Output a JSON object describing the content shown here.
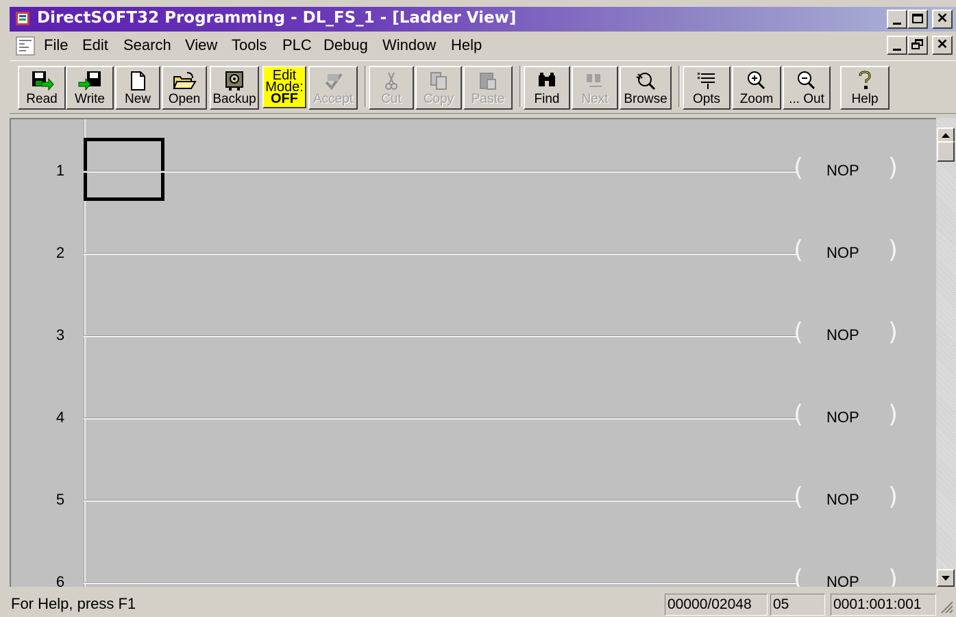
{
  "window": {
    "title": "DirectSOFT32 Programming - DL_FS_1 - [Ladder View]",
    "caption_buttons": [
      "minimize",
      "maximize",
      "close"
    ],
    "mdi_buttons": [
      "minimize",
      "restore",
      "close"
    ]
  },
  "menu": {
    "items": [
      {
        "label": "File"
      },
      {
        "label": "Edit"
      },
      {
        "label": "Search"
      },
      {
        "label": "View"
      },
      {
        "label": "Tools"
      },
      {
        "label": "PLC"
      },
      {
        "label": "Debug"
      },
      {
        "label": "Window"
      },
      {
        "label": "Help"
      }
    ]
  },
  "toolbar": {
    "read": "Read",
    "write": "Write",
    "new": "New",
    "open": "Open",
    "backup": "Backup",
    "edit_mode": {
      "line1": "Edit",
      "line2": "Mode:",
      "state": "OFF"
    },
    "accept": "Accept",
    "cut": "Cut",
    "copy": "Copy",
    "paste": "Paste",
    "find": "Find",
    "next": "Next",
    "browse": "Browse",
    "opts": "Opts",
    "zoom": "Zoom",
    "zoom_out": "... Out",
    "help": "Help"
  },
  "ladder": {
    "rungs": [
      {
        "number": "1",
        "coil": "NOP"
      },
      {
        "number": "2",
        "coil": "NOP"
      },
      {
        "number": "3",
        "coil": "NOP"
      },
      {
        "number": "4",
        "coil": "NOP"
      },
      {
        "number": "5",
        "coil": "NOP"
      },
      {
        "number": "6",
        "coil": "NOP"
      }
    ],
    "coil_left": "(",
    "coil_right": ")"
  },
  "status": {
    "help_text": "For Help, press F1",
    "memory": "00000/02048",
    "cpu": "05",
    "position": "0001:001:001"
  },
  "colors": {
    "titlebar_start": "#5c1fb0",
    "edit_mode_bg": "#ffff00",
    "ladder_bg": "#c0c0c0"
  }
}
